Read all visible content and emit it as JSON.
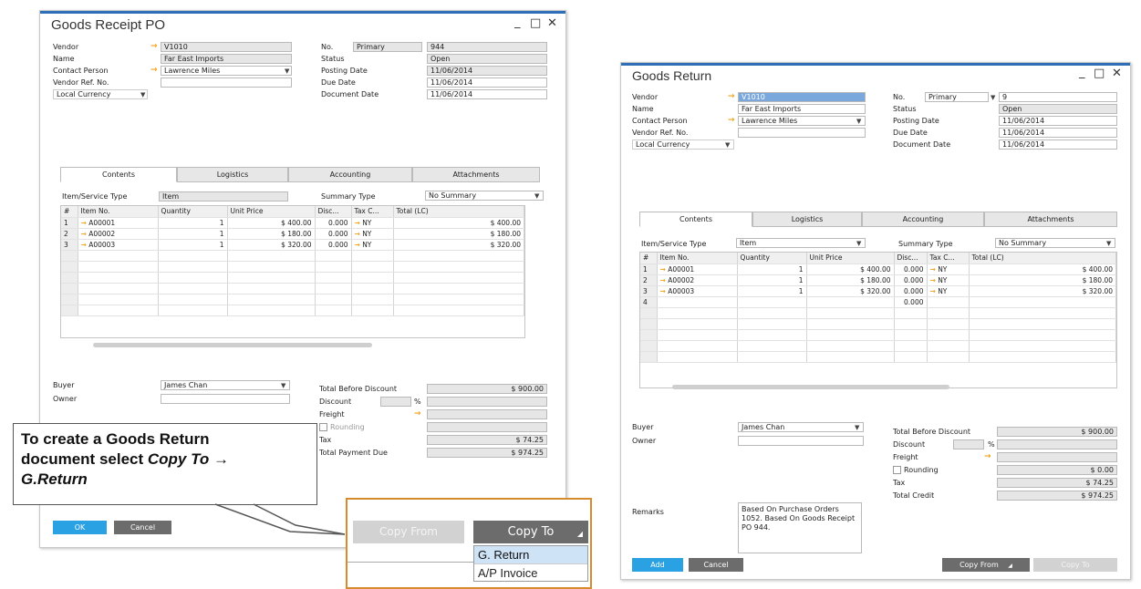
{
  "grpo": {
    "title": "Goods Receipt PO",
    "labels": {
      "vendor": "Vendor",
      "name": "Name",
      "contact": "Contact Person",
      "ref": "Vendor Ref. No.",
      "currency": "Local Currency",
      "no": "No.",
      "status": "Status",
      "posting": "Posting Date",
      "due": "Due Date",
      "docdate": "Document Date"
    },
    "values": {
      "vendor": "V1010",
      "name": "Far East Imports",
      "contact": "Lawrence Miles",
      "ref": "",
      "series": "Primary",
      "no": "944",
      "status": "Open",
      "posting": "11/06/2014",
      "due": "11/06/2014",
      "docdate": "11/06/2014"
    },
    "tabs": [
      "Contents",
      "Logistics",
      "Accounting",
      "Attachments"
    ],
    "item_type_label": "Item/Service Type",
    "item_type_value": "Item",
    "summary_label": "Summary Type",
    "summary_value": "No Summary",
    "columns": [
      "#",
      "Item No.",
      "Quantity",
      "Unit Price",
      "Disc...",
      "Tax C...",
      "Total (LC)"
    ],
    "rows": [
      {
        "n": "1",
        "item": "A00001",
        "qty": "1",
        "price": "$ 400.00",
        "disc": "0.000",
        "tax": "NY",
        "total": "$ 400.00"
      },
      {
        "n": "2",
        "item": "A00002",
        "qty": "1",
        "price": "$ 180.00",
        "disc": "0.000",
        "tax": "NY",
        "total": "$ 180.00"
      },
      {
        "n": "3",
        "item": "A00003",
        "qty": "1",
        "price": "$ 320.00",
        "disc": "0.000",
        "tax": "NY",
        "total": "$ 320.00"
      }
    ],
    "footer": {
      "buyer_label": "Buyer",
      "buyer": "James Chan",
      "owner_label": "Owner",
      "tbd_label": "Total Before Discount",
      "tbd": "$ 900.00",
      "discount_label": "Discount",
      "percent": "%",
      "freight_label": "Freight",
      "rounding_label": "Rounding",
      "tax_label": "Tax",
      "tax": "$ 74.25",
      "tpd_label": "Total Payment Due",
      "tpd": "$ 974.25"
    },
    "buttons": {
      "ok": "OK",
      "cancel": "Cancel"
    }
  },
  "callout": {
    "line1": "To create a Goods Return",
    "line2": "document select ",
    "line2_em": "Copy To →",
    "line3": "G.Return"
  },
  "zoom": {
    "copy_from": "Copy From",
    "copy_to": "Copy To",
    "menu": [
      "G. Return",
      "A/P Invoice"
    ]
  },
  "gr": {
    "title": "Goods Return",
    "labels": {
      "vendor": "Vendor",
      "name": "Name",
      "contact": "Contact Person",
      "ref": "Vendor Ref. No.",
      "currency": "Local Currency",
      "no": "No.",
      "status": "Status",
      "posting": "Posting Date",
      "due": "Due Date",
      "docdate": "Document Date"
    },
    "values": {
      "vendor": "V1010",
      "name": "Far East Imports",
      "contact": "Lawrence Miles",
      "ref": "",
      "series": "Primary",
      "no": "9",
      "status": "Open",
      "posting": "11/06/2014",
      "due": "11/06/2014",
      "docdate": "11/06/2014"
    },
    "tabs": [
      "Contents",
      "Logistics",
      "Accounting",
      "Attachments"
    ],
    "item_type_label": "Item/Service Type",
    "item_type_value": "Item",
    "summary_label": "Summary Type",
    "summary_value": "No Summary",
    "columns": [
      "#",
      "Item No.",
      "Quantity",
      "Unit Price",
      "Disc...",
      "Tax C...",
      "Total (LC)"
    ],
    "rows": [
      {
        "n": "1",
        "item": "A00001",
        "qty": "1",
        "price": "$ 400.00",
        "disc": "0.000",
        "tax": "NY",
        "total": "$ 400.00"
      },
      {
        "n": "2",
        "item": "A00002",
        "qty": "1",
        "price": "$ 180.00",
        "disc": "0.000",
        "tax": "NY",
        "total": "$ 180.00"
      },
      {
        "n": "3",
        "item": "A00003",
        "qty": "1",
        "price": "$ 320.00",
        "disc": "0.000",
        "tax": "NY",
        "total": "$ 320.00"
      },
      {
        "n": "4",
        "item": "",
        "qty": "",
        "price": "",
        "disc": "0.000",
        "tax": "",
        "total": ""
      }
    ],
    "footer": {
      "buyer_label": "Buyer",
      "buyer": "James Chan",
      "owner_label": "Owner",
      "tbd_label": "Total Before Discount",
      "tbd": "$ 900.00",
      "discount_label": "Discount",
      "percent": "%",
      "freight_label": "Freight",
      "rounding_label": "Rounding",
      "rounding": "$ 0.00",
      "tax_label": "Tax",
      "tax": "$ 74.25",
      "tc_label": "Total Credit",
      "tc": "$ 974.25",
      "remarks_label": "Remarks",
      "remarks": "Based On Purchase Orders 1052. Based On Goods Receipt PO 944."
    },
    "buttons": {
      "add": "Add",
      "cancel": "Cancel",
      "copy_from": "Copy From",
      "copy_to": "Copy To"
    }
  },
  "window_controls": {
    "minimize": "_",
    "maximize": "□",
    "close": "✕"
  },
  "colors": {
    "accent": "#2aa1e2",
    "arrow": "#f0a21c",
    "title_bar": "#2f6fb7",
    "zoom_border": "#d88a2e"
  }
}
